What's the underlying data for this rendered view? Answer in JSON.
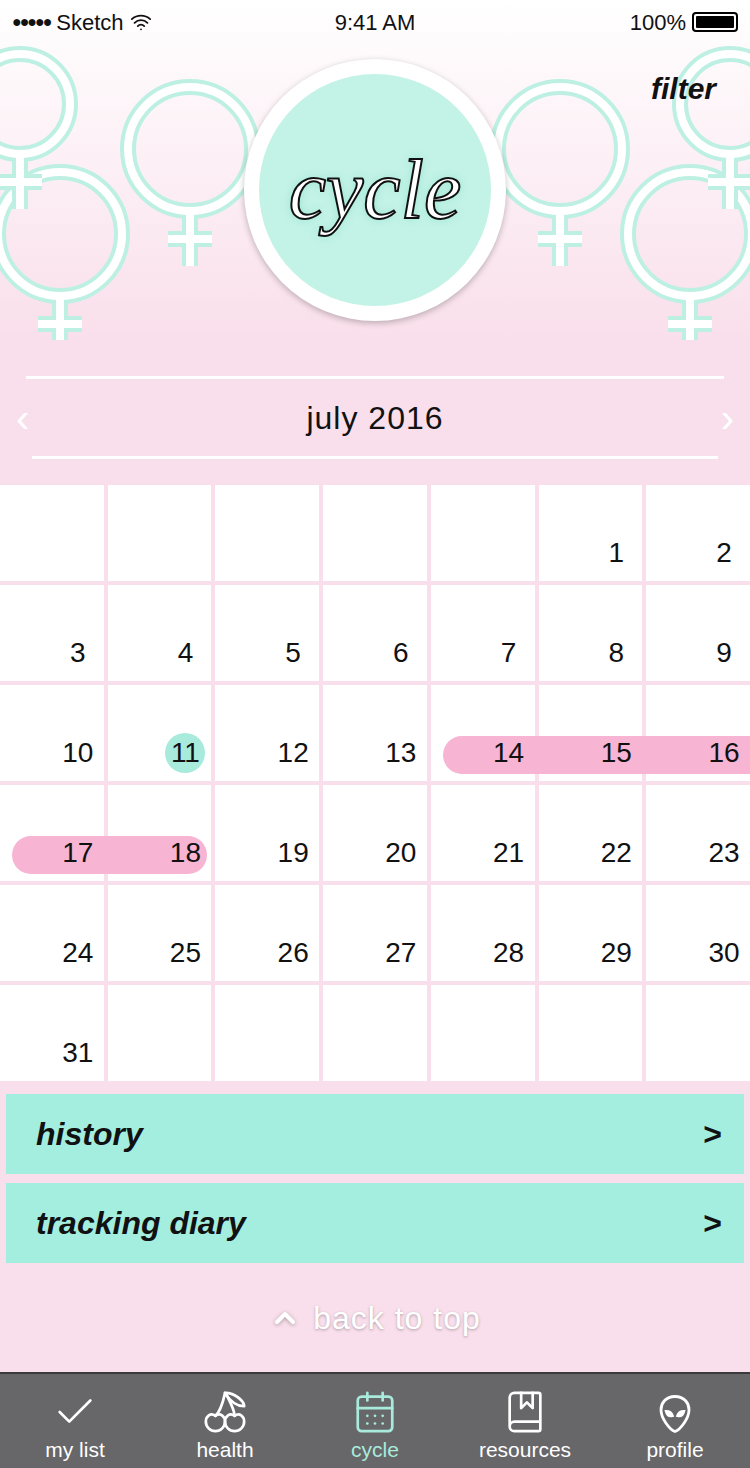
{
  "status_bar": {
    "signal": "●●●●●",
    "carrier": "Sketch",
    "time": "9:41 AM",
    "battery": "100%"
  },
  "header": {
    "title": "cycle",
    "filter": "filter"
  },
  "month_nav": {
    "prev": "‹",
    "label": "july 2016",
    "next": "›"
  },
  "calendar": {
    "weeks": [
      [
        {
          "day": "",
          "today": false,
          "period": false
        },
        {
          "day": "",
          "today": false,
          "period": false
        },
        {
          "day": "",
          "today": false,
          "period": false
        },
        {
          "day": "",
          "today": false,
          "period": false
        },
        {
          "day": "",
          "today": false,
          "period": false
        },
        {
          "day": "1",
          "today": false,
          "period": false
        },
        {
          "day": "2",
          "today": false,
          "period": false
        }
      ],
      [
        {
          "day": "3",
          "today": false,
          "period": false
        },
        {
          "day": "4",
          "today": false,
          "period": false
        },
        {
          "day": "5",
          "today": false,
          "period": false
        },
        {
          "day": "6",
          "today": false,
          "period": false
        },
        {
          "day": "7",
          "today": false,
          "period": false
        },
        {
          "day": "8",
          "today": false,
          "period": false
        },
        {
          "day": "9",
          "today": false,
          "period": false
        }
      ],
      [
        {
          "day": "10",
          "today": false,
          "period": false
        },
        {
          "day": "11",
          "today": true,
          "period": false
        },
        {
          "day": "12",
          "today": false,
          "period": false
        },
        {
          "day": "13",
          "today": false,
          "period": false
        },
        {
          "day": "14",
          "today": false,
          "period": true
        },
        {
          "day": "15",
          "today": false,
          "period": true
        },
        {
          "day": "16",
          "today": false,
          "period": true
        }
      ],
      [
        {
          "day": "17",
          "today": false,
          "period": true
        },
        {
          "day": "18",
          "today": false,
          "period": true
        },
        {
          "day": "19",
          "today": false,
          "period": false
        },
        {
          "day": "20",
          "today": false,
          "period": false
        },
        {
          "day": "21",
          "today": false,
          "period": false
        },
        {
          "day": "22",
          "today": false,
          "period": false
        },
        {
          "day": "23",
          "today": false,
          "period": false
        }
      ],
      [
        {
          "day": "24",
          "today": false,
          "period": false
        },
        {
          "day": "25",
          "today": false,
          "period": false
        },
        {
          "day": "26",
          "today": false,
          "period": false
        },
        {
          "day": "27",
          "today": false,
          "period": false
        },
        {
          "day": "28",
          "today": false,
          "period": false
        },
        {
          "day": "29",
          "today": false,
          "period": false
        },
        {
          "day": "30",
          "today": false,
          "period": false
        }
      ],
      [
        {
          "day": "31",
          "today": false,
          "period": false
        },
        {
          "day": "",
          "today": false,
          "period": false
        },
        {
          "day": "",
          "today": false,
          "period": false
        },
        {
          "day": "",
          "today": false,
          "period": false
        },
        {
          "day": "",
          "today": false,
          "period": false
        },
        {
          "day": "",
          "today": false,
          "period": false
        },
        {
          "day": "",
          "today": false,
          "period": false
        }
      ]
    ]
  },
  "links": [
    {
      "label": "history",
      "chevron": ">"
    },
    {
      "label": "tracking diary",
      "chevron": ">"
    }
  ],
  "back_to_top": {
    "label": "back to top"
  },
  "tab_bar": [
    {
      "label": "my list",
      "selected": false
    },
    {
      "label": "health",
      "selected": false
    },
    {
      "label": "cycle",
      "selected": true
    },
    {
      "label": "resources",
      "selected": false
    },
    {
      "label": "profile",
      "selected": false
    }
  ]
}
